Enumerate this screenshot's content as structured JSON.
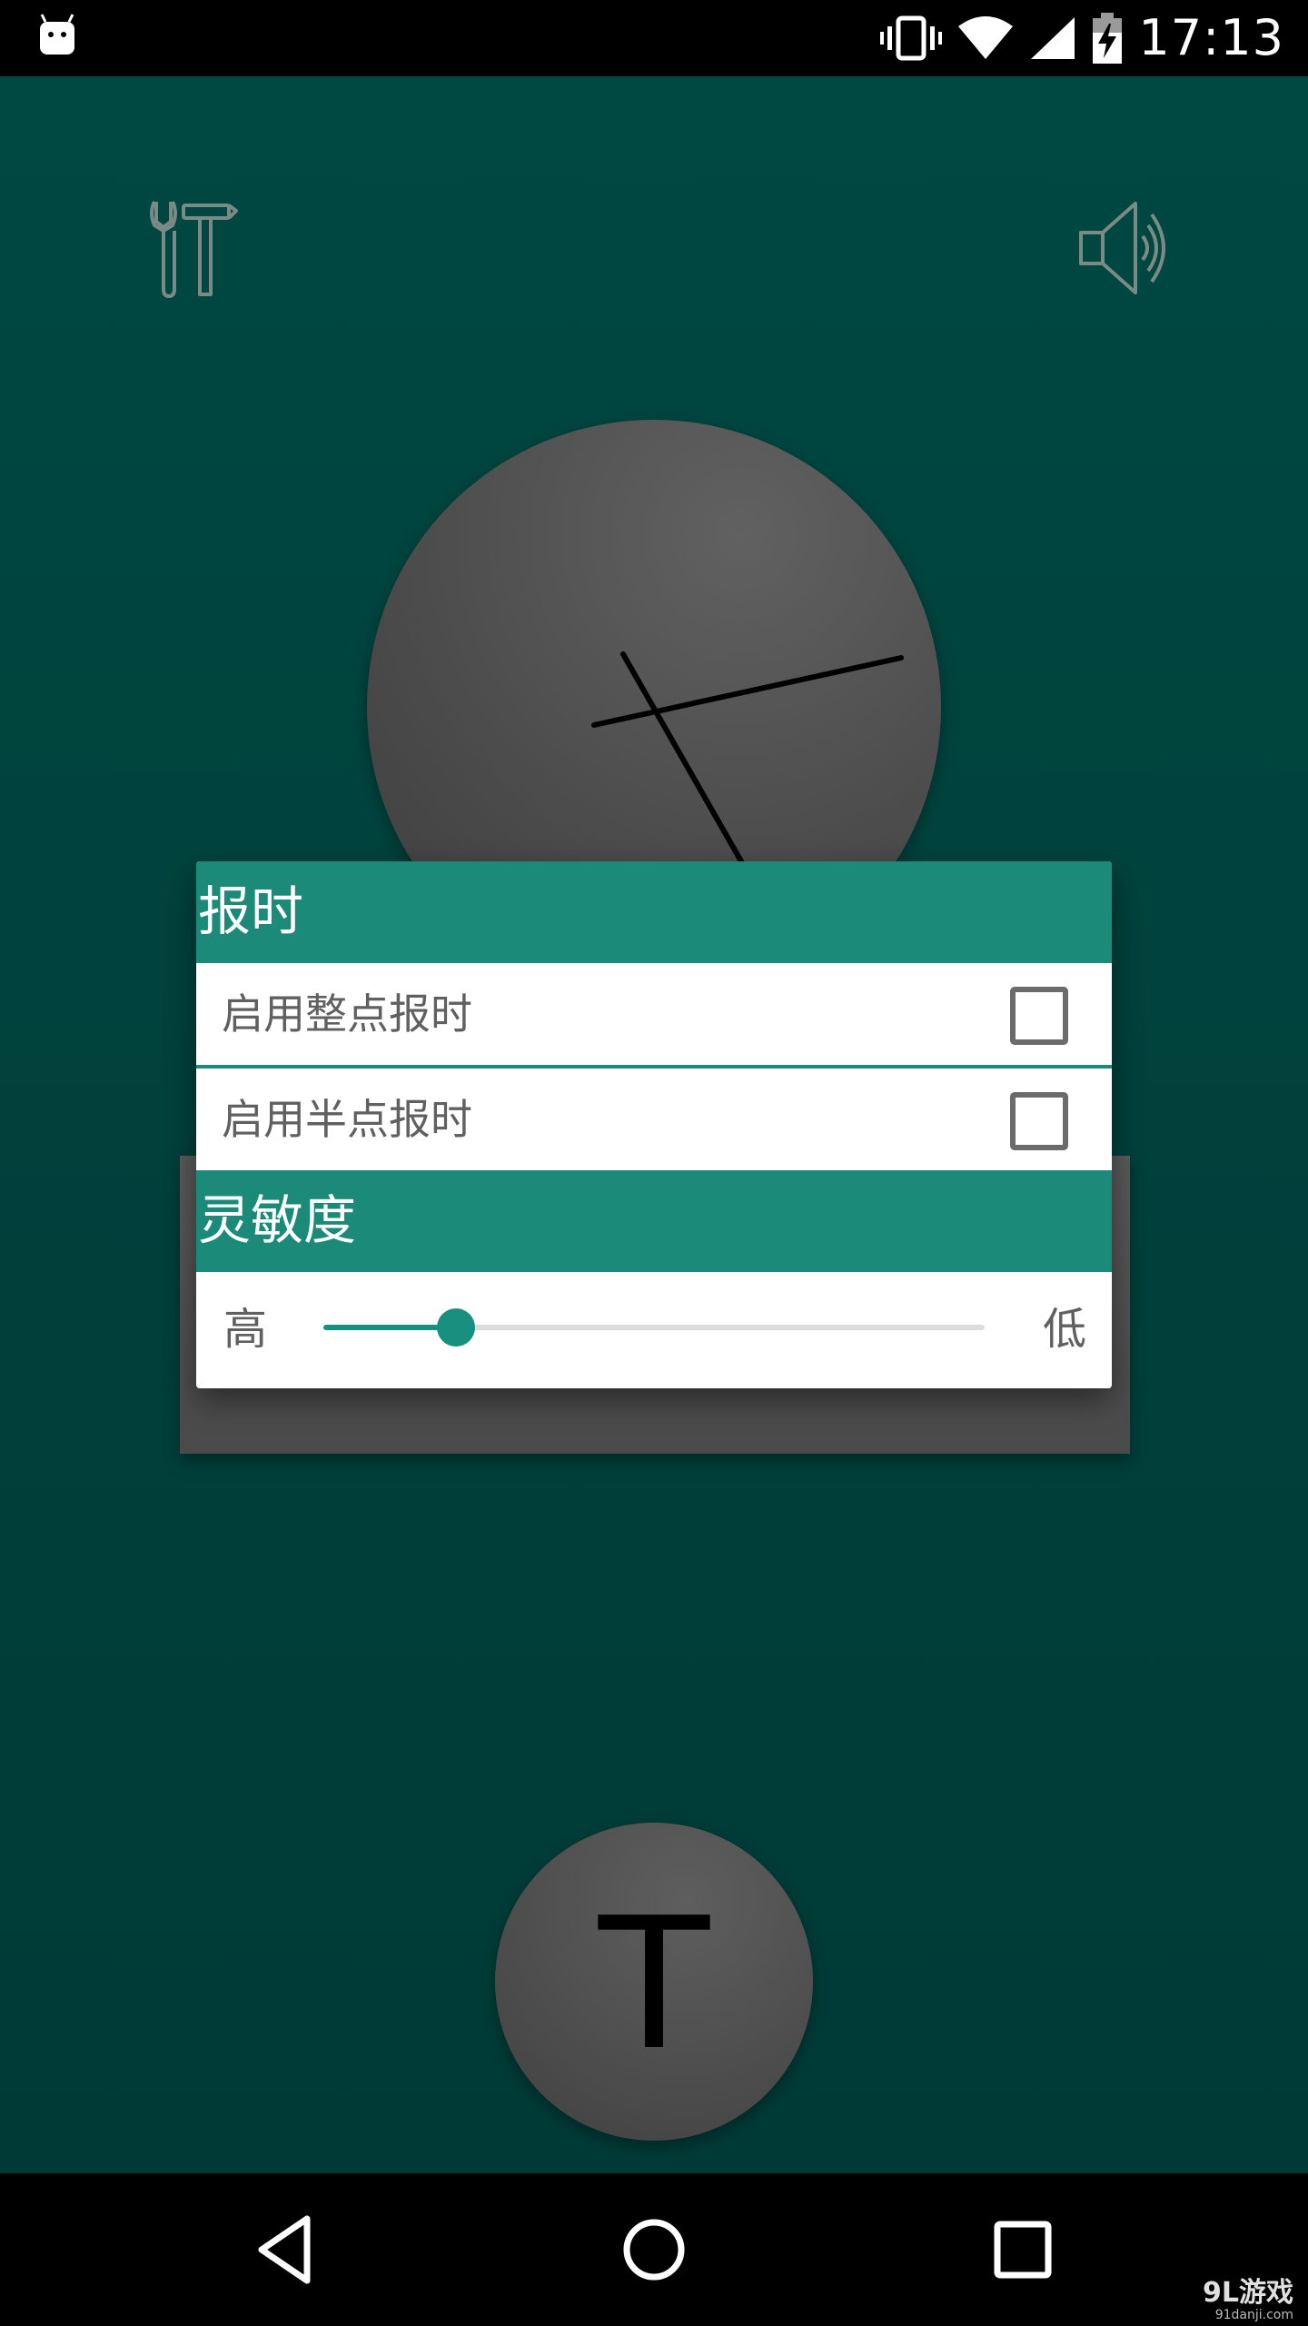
{
  "status_bar": {
    "time": "17:13"
  },
  "icons": {
    "status_left": "android-icon",
    "vibrate": "vibrate-icon",
    "wifi": "wifi-icon",
    "signal": "signal-icon",
    "battery": "battery-charging-icon",
    "tools": "tools-icon",
    "speaker": "speaker-icon"
  },
  "colors": {
    "background": "#00403a",
    "header": "#1b8a78",
    "accent": "#17907f"
  },
  "dialog": {
    "section1_title": "报时",
    "hourly_label": "启用整点报时",
    "hourly_checked": false,
    "half_hour_label": "启用半点报时",
    "half_hour_checked": false,
    "section2_title": "灵敏度",
    "slider": {
      "min_label": "高",
      "max_label": "低",
      "value": 0.2
    }
  },
  "main": {
    "t_button_label": "T"
  },
  "watermark": {
    "main": "9L游戏",
    "sub": "91danji.com"
  }
}
